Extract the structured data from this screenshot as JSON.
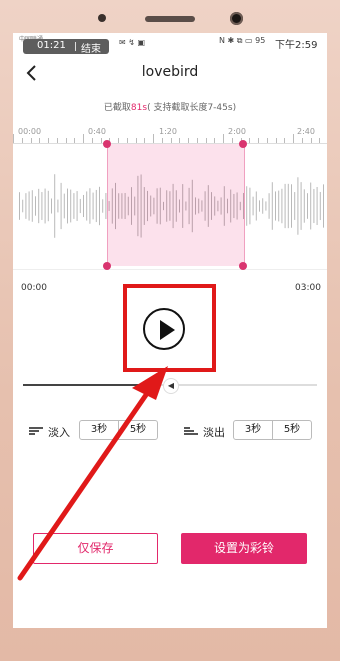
{
  "status_bar": {
    "carrier": "中国联通",
    "rec_time": "01:21",
    "rec_end": "结束",
    "icons_left": "✉ ↯ ▣",
    "icons_right": "N ✱ ⧉ ▭ 95",
    "clock": "下午2:59"
  },
  "header": {
    "back_icon": "chevron-left-icon",
    "title": "lovebird"
  },
  "clip": {
    "prefix": "已截取",
    "length": "81s",
    "suffix": "( 支持截取长度7-45s)"
  },
  "ruler_labels": [
    "00:00",
    "0:40",
    "1:20",
    "2:00",
    "2:40"
  ],
  "times": {
    "start": "00:00",
    "end": "03:00"
  },
  "player": {
    "play_icon": "play-icon",
    "progress": 0.46,
    "volume_icon": "speaker-icon"
  },
  "fade_in": {
    "label": "淡入",
    "options": [
      "3秒",
      "5秒"
    ]
  },
  "fade_out": {
    "label": "淡出",
    "options": [
      "3秒",
      "5秒"
    ]
  },
  "buttons": {
    "save": "仅保存",
    "set_ringtone": "设置为彩铃"
  },
  "colors": {
    "accent": "#e2286b",
    "highlight": "#e01919"
  }
}
